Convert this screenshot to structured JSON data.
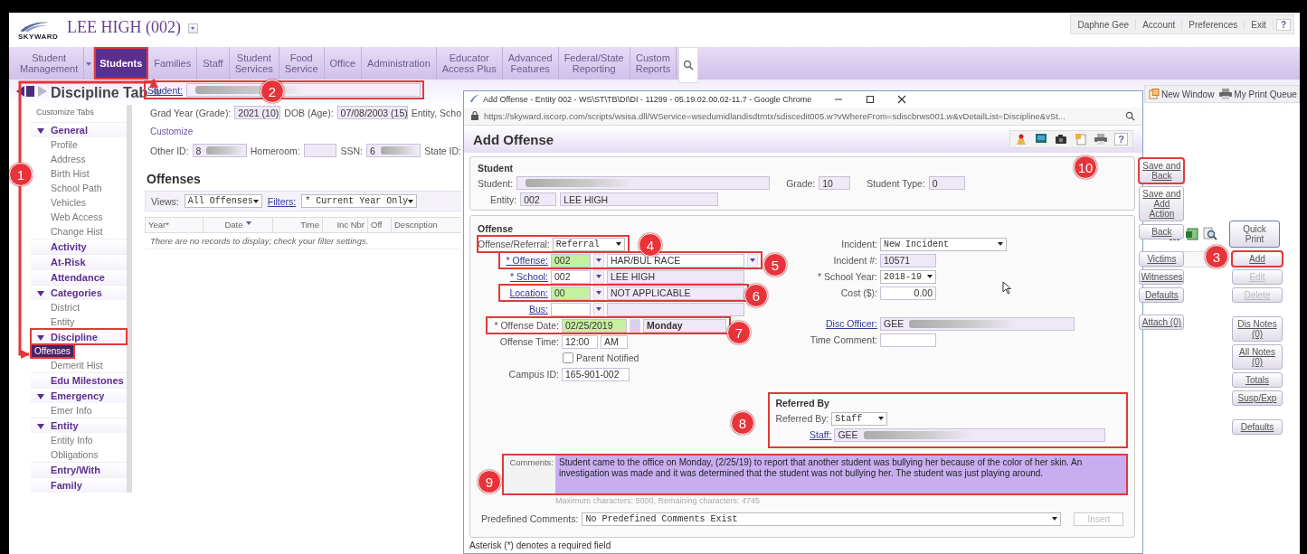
{
  "header": {
    "logo": "SKYWARD",
    "school": "LEE HIGH (002)",
    "user_menu": [
      "Daphne Gee",
      "Account",
      "Preferences",
      "Exit",
      "?"
    ]
  },
  "nav": [
    {
      "label": "Student\nManagement",
      "selected": false,
      "has_menu": true,
      "highlighted": false
    },
    {
      "label": "Students",
      "selected": true,
      "has_menu": false,
      "highlighted": true
    },
    {
      "label": "Families",
      "selected": false,
      "has_menu": false,
      "highlighted": false
    },
    {
      "label": "Staff",
      "selected": false,
      "has_menu": false,
      "highlighted": false
    },
    {
      "label": "Student\nServices",
      "selected": false,
      "has_menu": false,
      "highlighted": false
    },
    {
      "label": "Food\nService",
      "selected": false,
      "has_menu": false,
      "highlighted": false
    },
    {
      "label": "Office",
      "selected": false,
      "has_menu": false,
      "highlighted": false
    },
    {
      "label": "Administration",
      "selected": false,
      "has_menu": false,
      "highlighted": false
    },
    {
      "label": "Educator\nAccess Plus",
      "selected": false,
      "has_menu": false,
      "highlighted": false
    },
    {
      "label": "Advanced\nFeatures",
      "selected": false,
      "has_menu": false,
      "highlighted": false
    },
    {
      "label": "Federal/State\nReporting",
      "selected": false,
      "has_menu": false,
      "highlighted": false
    },
    {
      "label": "Custom\nReports",
      "selected": false,
      "has_menu": false,
      "highlighted": false
    }
  ],
  "page_title": "Discipline Tab",
  "sidebar": {
    "customize": "Customize Tabs",
    "groups": [
      {
        "label": "General",
        "expanded": true,
        "highlighted": false,
        "children": [
          {
            "label": "Profile",
            "selected": false
          },
          {
            "label": "Address",
            "selected": false
          },
          {
            "label": "Birth Hist",
            "selected": false
          },
          {
            "label": "School Path",
            "selected": false
          },
          {
            "label": "Vehicles",
            "selected": false
          },
          {
            "label": "Web Access",
            "selected": false
          },
          {
            "label": "Change Hist",
            "selected": false
          }
        ]
      },
      {
        "label": "Activity",
        "expanded": false,
        "highlighted": false
      },
      {
        "label": "At-Risk",
        "expanded": false,
        "highlighted": false
      },
      {
        "label": "Attendance",
        "expanded": false,
        "highlighted": false
      },
      {
        "label": "Categories",
        "expanded": true,
        "highlighted": false,
        "children": [
          {
            "label": "District",
            "selected": false
          },
          {
            "label": "Entity",
            "selected": false
          }
        ]
      },
      {
        "label": "Discipline",
        "expanded": true,
        "highlighted": true,
        "children": [
          {
            "label": "Offenses",
            "selected": true
          },
          {
            "label": "Demerit Hist",
            "selected": false
          }
        ]
      },
      {
        "label": "Edu Milestones",
        "expanded": false,
        "highlighted": false
      },
      {
        "label": "Emergency",
        "expanded": true,
        "highlighted": false,
        "children": [
          {
            "label": "Emer Info",
            "selected": false
          }
        ]
      },
      {
        "label": "Entity",
        "expanded": true,
        "highlighted": false,
        "children": [
          {
            "label": "Entity Info",
            "selected": false
          },
          {
            "label": "Obligations",
            "selected": false
          }
        ]
      },
      {
        "label": "Entry/With",
        "expanded": false,
        "highlighted": false
      },
      {
        "label": "Family",
        "expanded": false,
        "highlighted": false
      }
    ]
  },
  "student_bar": {
    "label": "Student:",
    "highlighted": true
  },
  "profile": {
    "grad_year": {
      "label": "Grad Year (Grade):",
      "value": "2021 (10)"
    },
    "dob": {
      "label": "DOB (Age):",
      "value": "07/08/2003 (15)"
    },
    "entity": {
      "label": "Entity, Scho"
    },
    "customize": "Customize",
    "other_id": {
      "label": "Other ID:",
      "value": "8"
    },
    "homeroom": {
      "label": "Homeroom:"
    },
    "ssn": {
      "label": "SSN:",
      "value": "6"
    },
    "state_id": {
      "label": "State ID:"
    }
  },
  "offenses": {
    "title": "Offenses",
    "views_label": "Views:",
    "view": "All Offenses",
    "filters_label": "Filters:",
    "filter": "* Current Year Only",
    "columns": [
      "Year*",
      "Date",
      "Time",
      "Inc Nbr",
      "Off",
      "Description"
    ],
    "empty": "There are no records to display; check your filter settings."
  },
  "right_panel": {
    "toolbar": [
      "New Window",
      "My Print Queue"
    ],
    "quick_print": "Quick\nPrint",
    "buttons": [
      {
        "label": "Add",
        "disabled": false,
        "highlighted": true
      },
      {
        "label": "Edit",
        "disabled": true,
        "highlighted": false
      },
      {
        "label": "Delete",
        "disabled": true,
        "highlighted": false
      },
      {
        "label": "Dis Notes\n(0)",
        "disabled": false,
        "highlighted": false
      },
      {
        "label": "All Notes (0)",
        "disabled": false,
        "highlighted": false
      },
      {
        "label": "Totals",
        "disabled": false,
        "highlighted": false
      },
      {
        "label": "Susp/Exp",
        "disabled": false,
        "highlighted": false
      },
      {
        "label": "Defaults",
        "disabled": false,
        "highlighted": false
      }
    ]
  },
  "popup": {
    "window_title": "Add Offense - Entity 002 - WS\\ST\\TB\\DI\\DI - 11299 - 05.19.02.00.02-11.7 - Google Chrome",
    "url": "https://skyward.iscorp.com/scripts/wsisa.dll/WService=wsedumidlandisdtrntx/sdiscedit005.w?vWhereFrom=sdiscbrws001.w&vDetailList=Discipline&vSt...",
    "title": "Add Offense",
    "help": "?",
    "student": {
      "title": "Student",
      "student_label": "Student:",
      "grade_label": "Grade:",
      "grade": "10",
      "type_label": "Student Type:",
      "type": "0",
      "entity_label": "Entity:",
      "entity_code": "002",
      "entity_name": "LEE HIGH"
    },
    "offense": {
      "title": "Offense",
      "referral": {
        "label": "Offense/Referral:",
        "value": "Referral",
        "highlighted": true
      },
      "offense_code": {
        "label": "* Offense:",
        "code": "002",
        "description": "HAR/BUL RACE",
        "edited": true,
        "highlighted": true
      },
      "school": {
        "label": "* School:",
        "code": "002",
        "description": "LEE HIGH",
        "edited": false,
        "highlighted": false
      },
      "location": {
        "label": "Location:",
        "code": "00",
        "description": "NOT APPLICABLE",
        "edited": true,
        "highlighted": true
      },
      "bus": {
        "label": "Bus:"
      },
      "offense_date": {
        "label": "* Offense Date:",
        "value": "02/25/2019",
        "weekday": "Monday",
        "edited": true,
        "highlighted": true
      },
      "offense_time": {
        "label": "Offense Time:",
        "value": "12:00",
        "meridiem": "AM"
      },
      "parent_notified": {
        "label": "Parent Notified",
        "checked": false
      },
      "campus_id": {
        "label": "Campus ID:",
        "value": "165-901-002"
      },
      "incident": {
        "label": "Incident:",
        "value": "New Incident"
      },
      "incident_number": {
        "label": "Incident #:",
        "value": "10571"
      },
      "school_year": {
        "label": "* School Year:",
        "value": "2018-19"
      },
      "cost": {
        "label": "Cost ($):",
        "value": "0.00"
      },
      "disc_officer": {
        "label": "Disc Officer:",
        "value": "GEE"
      },
      "time_comment": {
        "label": "Time Comment:"
      }
    },
    "referred_by": {
      "title": "Referred By",
      "by_label": "Referred By:",
      "by": "Staff",
      "staff_label": "Staff:",
      "staff": "GEE",
      "highlighted": true
    },
    "comments": {
      "label": "Comments:",
      "value": "Student came to the office on Monday, (2/25/19) to report that another student was bullying her because of the color of her skin.  An investigation was made and it was determined that the student was not bullying her.  The student was just playing around.",
      "highlighted": true,
      "hint": "Maximum characters: 5000, Remaining characters: 4745"
    },
    "predefined": {
      "label": "Predefined Comments:",
      "value": "No Predefined Comments Exist",
      "insert": "Insert",
      "insert_disabled": true
    },
    "footer": "Asterisk (*) denotes a required field",
    "buttons": [
      {
        "label": "Save and\nBack",
        "highlighted": true
      },
      {
        "label": "Save and\nAdd Action",
        "highlighted": false
      },
      {
        "label": "Back",
        "highlighted": false
      },
      {
        "label": "Victims",
        "highlighted": false
      },
      {
        "label": "Witnesses",
        "highlighted": false
      },
      {
        "label": "Defaults",
        "highlighted": false
      },
      {
        "label": "Attach (0)",
        "highlighted": false
      }
    ]
  },
  "callouts": [
    "1",
    "2",
    "3",
    "4",
    "5",
    "6",
    "7",
    "8",
    "9",
    "10"
  ]
}
